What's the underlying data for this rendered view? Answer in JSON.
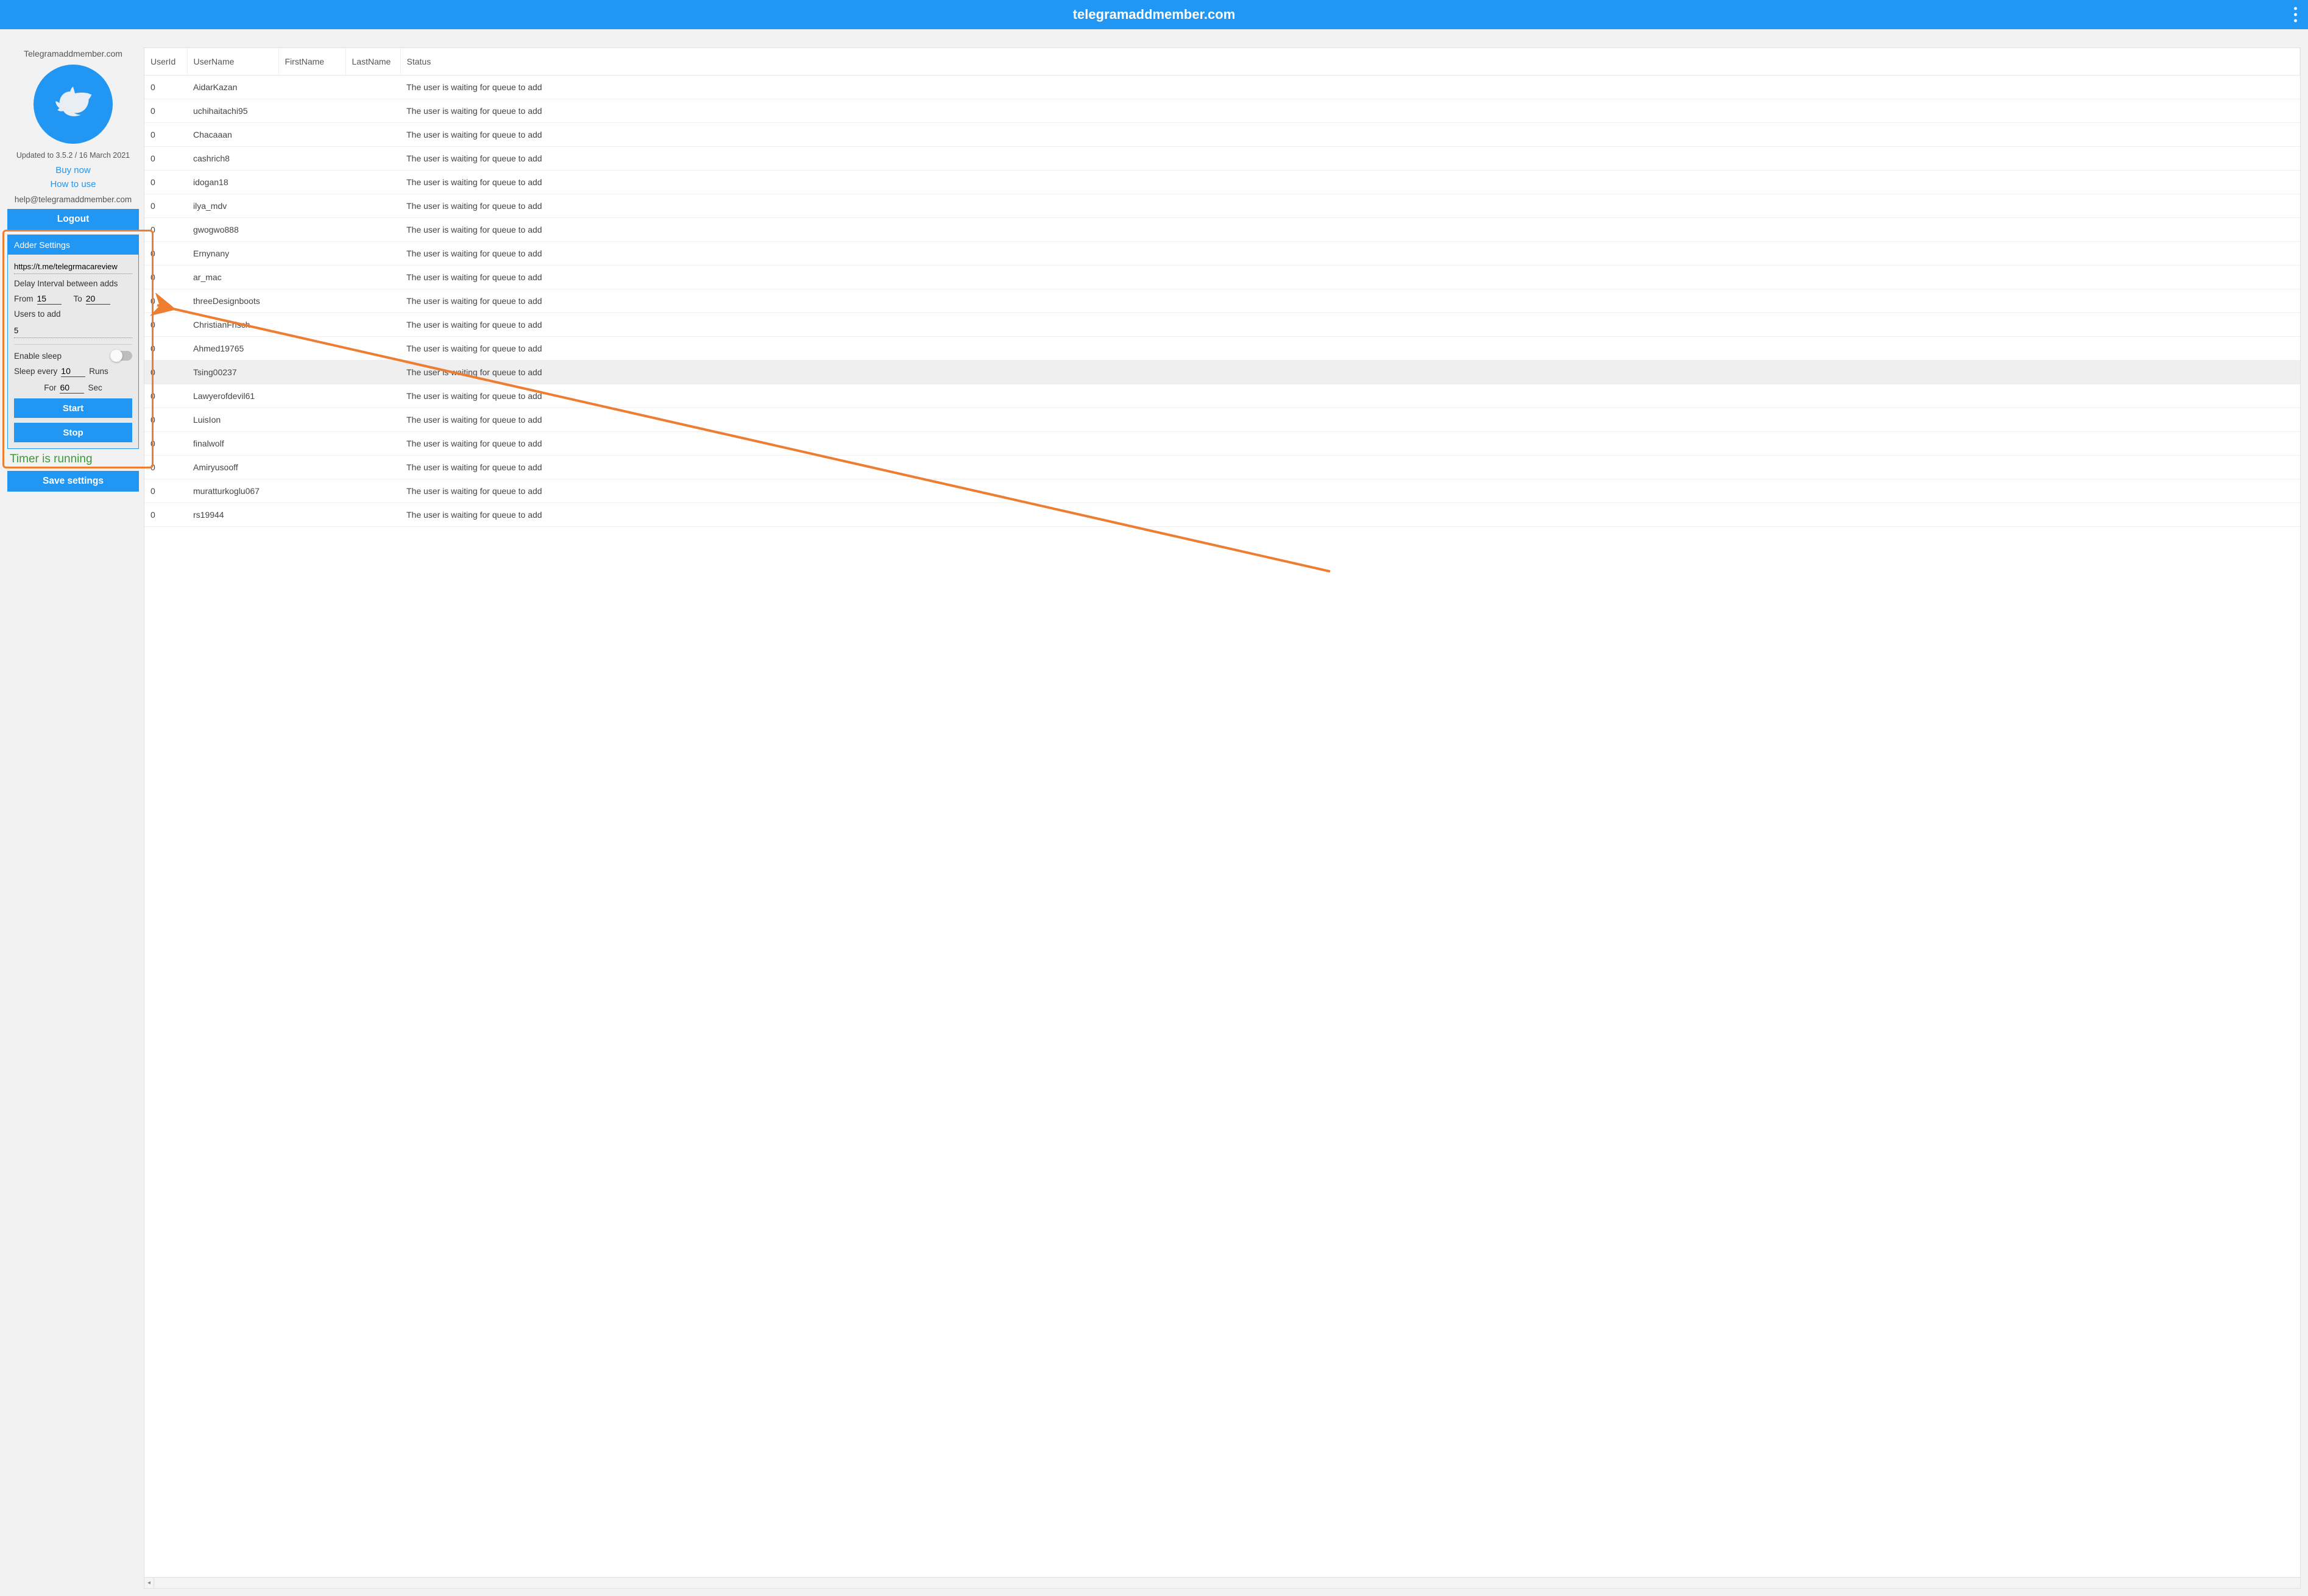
{
  "header": {
    "title": "telegramaddmember.com"
  },
  "sidebar": {
    "brand": "Telegramaddmember.com",
    "updated": "Updated to 3.5.2 / 16 March 2021",
    "link_buy": "Buy now",
    "link_howto": "How to use",
    "email": "help@telegramaddmember.com",
    "logout_label": "Logout",
    "save_label": "Save settings",
    "timer_text": "Timer is running"
  },
  "adder": {
    "panel_title": "Adder Settings",
    "url": "https://t.me/telegrmacareview",
    "delay_label": "Delay Interval between adds",
    "from_label": "From",
    "to_label": "To",
    "from_value": "15",
    "to_value": "20",
    "users_label": "Users to add",
    "users_value": "5",
    "sleep_enable_label": "Enable sleep",
    "sleep_enabled": false,
    "sleep_every_label": "Sleep every",
    "sleep_every_value": "10",
    "runs_label": "Runs",
    "for_label": "For",
    "for_value": "60",
    "sec_label": "Sec",
    "start_label": "Start",
    "stop_label": "Stop"
  },
  "table": {
    "columns": {
      "userid": "UserId",
      "username": "UserName",
      "firstname": "FirstName",
      "lastname": "LastName",
      "status": "Status"
    },
    "status_template": "The user is waiting for queue to add",
    "rows": [
      {
        "userid": "0",
        "username": "AidarKazan",
        "firstname": "",
        "lastname": "",
        "status": "The user is waiting for queue to add",
        "selected": false
      },
      {
        "userid": "0",
        "username": "uchihaitachi95",
        "firstname": "",
        "lastname": "",
        "status": "The user is waiting for queue to add",
        "selected": false
      },
      {
        "userid": "0",
        "username": "Chacaaan",
        "firstname": "",
        "lastname": "",
        "status": "The user is waiting for queue to add",
        "selected": false
      },
      {
        "userid": "0",
        "username": "cashrich8",
        "firstname": "",
        "lastname": "",
        "status": "The user is waiting for queue to add",
        "selected": false
      },
      {
        "userid": "0",
        "username": "idogan18",
        "firstname": "",
        "lastname": "",
        "status": "The user is waiting for queue to add",
        "selected": false
      },
      {
        "userid": "0",
        "username": "ilya_mdv",
        "firstname": "",
        "lastname": "",
        "status": "The user is waiting for queue to add",
        "selected": false
      },
      {
        "userid": "0",
        "username": "gwogwo888",
        "firstname": "",
        "lastname": "",
        "status": "The user is waiting for queue to add",
        "selected": false
      },
      {
        "userid": "0",
        "username": "Ernynany",
        "firstname": "",
        "lastname": "",
        "status": "The user is waiting for queue to add",
        "selected": false
      },
      {
        "userid": "0",
        "username": "ar_mac",
        "firstname": "",
        "lastname": "",
        "status": "The user is waiting for queue to add",
        "selected": false
      },
      {
        "userid": "0",
        "username": "threeDesignboots",
        "firstname": "",
        "lastname": "",
        "status": "The user is waiting for queue to add",
        "selected": false
      },
      {
        "userid": "0",
        "username": "ChristianFrisch",
        "firstname": "",
        "lastname": "",
        "status": "The user is waiting for queue to add",
        "selected": false
      },
      {
        "userid": "0",
        "username": "Ahmed19765",
        "firstname": "",
        "lastname": "",
        "status": "The user is waiting for queue to add",
        "selected": false
      },
      {
        "userid": "0",
        "username": "Tsing00237",
        "firstname": "",
        "lastname": "",
        "status": "The user is waiting for queue to add",
        "selected": true
      },
      {
        "userid": "0",
        "username": "Lawyerofdevil61",
        "firstname": "",
        "lastname": "",
        "status": "The user is waiting for queue to add",
        "selected": false
      },
      {
        "userid": "0",
        "username": "LuisIon",
        "firstname": "",
        "lastname": "",
        "status": "The user is waiting for queue to add",
        "selected": false
      },
      {
        "userid": "0",
        "username": "finalwolf",
        "firstname": "",
        "lastname": "",
        "status": "The user is waiting for queue to add",
        "selected": false
      },
      {
        "userid": "0",
        "username": "Amiryusooff",
        "firstname": "",
        "lastname": "",
        "status": "The user is waiting for queue to add",
        "selected": false
      },
      {
        "userid": "0",
        "username": "muratturkoglu067",
        "firstname": "",
        "lastname": "",
        "status": "The user is waiting for queue to add",
        "selected": false
      },
      {
        "userid": "0",
        "username": "rs19944",
        "firstname": "",
        "lastname": "",
        "status": "The user is waiting for queue to add",
        "selected": false
      }
    ]
  },
  "annotation": {
    "arrow_color": "#ed7d31"
  }
}
